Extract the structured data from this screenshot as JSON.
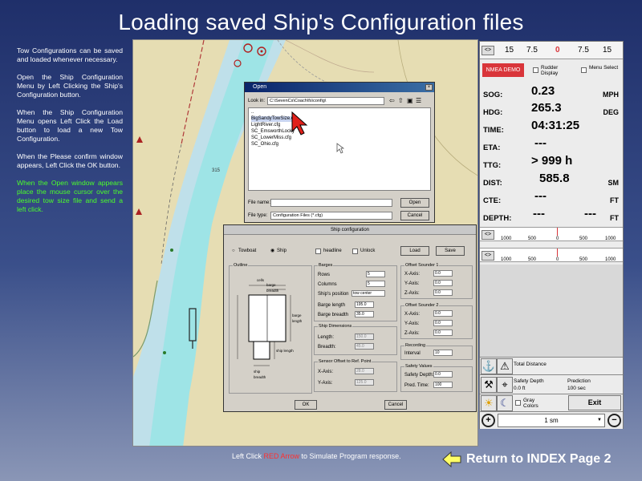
{
  "title": "Loading saved Ship's Configuration files",
  "instructions": [
    "Tow Configurations can be saved and loaded whenever necessary.",
    "Open the Ship Configuration Menu by Left Clicking the Ship's Configuration button.",
    "When the Ship Configuration Menu opens Left Click the Load button to load a new Tow Configuration.",
    "When the Please confirm window appears, Left Click the OK button.",
    "When the Open window appears place the mouse cursor over the desired tow size file and send a left click."
  ],
  "chart": {
    "depth_label": "315"
  },
  "panel": {
    "toggle": "<>",
    "rudder_scale": [
      "15",
      "7.5",
      "0",
      "7.5",
      "15"
    ],
    "nmea_button": "NMEA DEMO",
    "rudder_display": "Rudder Display",
    "menu_select": "Menu Select",
    "readouts": [
      {
        "label": "SOG:",
        "value": "0.23",
        "unit": "MPH"
      },
      {
        "label": "HDG:",
        "value": "265.3",
        "unit": "DEG"
      },
      {
        "label": "TIME:",
        "value": "04:31:25",
        "unit": ""
      },
      {
        "label": "ETA:",
        "value": "---",
        "unit": ""
      },
      {
        "label": "TTG:",
        "value": "> 999 h",
        "unit": ""
      },
      {
        "label": "DIST:",
        "value": "585.8",
        "unit": "SM"
      },
      {
        "label": "CTE:",
        "value": "---",
        "unit": "FT"
      },
      {
        "label": "DEPTH:",
        "value": "---",
        "value2": "---",
        "unit": "FT"
      }
    ],
    "scale_ticks": [
      "1000",
      "500",
      "0",
      "500",
      "1000"
    ],
    "total_distance": "Total Distance",
    "safety_depth_label": "Safety Depth",
    "safety_depth_value": "0.0 ft",
    "prediction_label": "Prediction",
    "prediction_value": "100 sec",
    "gray_colors": "Gray Colors",
    "exit": "Exit",
    "zoom_value": "1 sm"
  },
  "open_dialog": {
    "title": "Open",
    "look_in_label": "Look in:",
    "look_in_value": "C:\\SevenCs\\Coach\\fs\\config\\",
    "files": [
      "..",
      "BigSandyTowSize.cfg",
      "LightRiver.cfg",
      "SC_EmsworthLocky",
      "SC_LowerMiss.cfg",
      "SC_Ohio.cfg"
    ],
    "file_name_label": "File name:",
    "file_type_label": "File type:",
    "file_type_value": "Configuration Files (*.cfg)",
    "open_button": "Open",
    "cancel_button": "Cancel"
  },
  "ship_dialog": {
    "title": "Ship configuration",
    "towboat": "Towboat",
    "ship": "Ship",
    "headline": "headline",
    "unlock": "Unlock",
    "load": "Load",
    "save": "Save",
    "outline": "Outline",
    "barges": "Barges",
    "rows_label": "Rows",
    "rows_value": "5",
    "columns_label": "Columns",
    "columns_value": "5",
    "ships_position_label": "Ship's position",
    "ships_position_value": "tow center",
    "barge_length_label": "Barge length",
    "barge_length_value": "195.0",
    "barge_breadth_label": "Barge breadth",
    "barge_breadth_value": "35.0",
    "ship_dimensions": "Ship Dimensions",
    "length_label": "Length:",
    "length_value": "150.0",
    "breadth_label": "Breadth:",
    "breadth_value": "45.0",
    "sensor_offset": "Sensor Offset to Ref. Point",
    "x_axis_label": "X-Axis:",
    "x_axis_value": "28.0",
    "y_axis_label": "Y-Axis:",
    "y_axis_value": "125.0",
    "offset_sounder_1": "Offset Sounder 1",
    "offset_sounder_2": "Offset Sounder 2",
    "s1": {
      "x": "0.0",
      "y": "0.0",
      "z": "0.0"
    },
    "s2": {
      "x": "0.0",
      "y": "0.0",
      "z": "0.0"
    },
    "recording": "Recording",
    "interval_label": "Interval",
    "interval_value": "10",
    "safety_values": "Safety Values",
    "safety_depth_label": "Safety Depth:",
    "safety_depth_value": "0.0",
    "predict_time_label": "Pred. Time:",
    "predict_time_value": "100",
    "ok_button": "OK",
    "cancel_button": "Cancel",
    "diagram_labels": {
      "cells": "cells",
      "barge_breadth": "barge breadth",
      "barge_length": "barge length",
      "ship_length": "ship length",
      "ship_breadth": "ship breadth"
    }
  },
  "footer": {
    "pre": "Left Click ",
    "red": "RED Arrow",
    "post": " to Simulate Program response."
  },
  "return_link": "Return to INDEX Page 2",
  "colors": {
    "accent_red": "#ff3030",
    "green_text": "#4cff2a",
    "nmea_red": "#d9353a"
  }
}
